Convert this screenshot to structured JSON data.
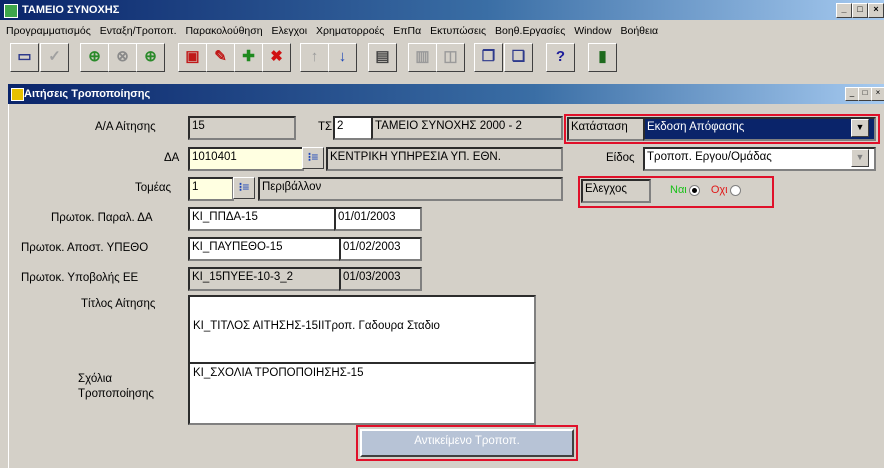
{
  "app": {
    "title": "ΤΑΜΕΙΟ ΣΥΝΟΧΗΣ",
    "controls": {
      "min": "_",
      "max": "□",
      "close": "×"
    }
  },
  "menu": [
    "Προγραμματισμός",
    "Ενταξη/Τροποπ.",
    "Παρακολούθηση",
    "Ελεγχοι",
    "Χρηματορροές",
    "ΕπΠα",
    "Εκτυπώσεις",
    "Βοηθ.Εργασίες",
    "Window",
    "Βοήθεια"
  ],
  "toolbar": {
    "icons": [
      {
        "name": "save-icon",
        "glyph": "▭",
        "color": "#2e3a8c"
      },
      {
        "name": "check-icon",
        "glyph": "✓",
        "color": "#a0a0a0"
      },
      {
        "name": "query-icon",
        "glyph": "⊕",
        "color": "#2a8a2a"
      },
      {
        "name": "query-cancel-icon",
        "glyph": "⊗",
        "color": "#8a8a8a"
      },
      {
        "name": "execute-query-icon",
        "glyph": "⊕",
        "color": "#2a8a2a"
      },
      {
        "name": "window-icon",
        "glyph": "▣",
        "color": "#c01818"
      },
      {
        "name": "edit-icon",
        "glyph": "✎",
        "color": "#c01818"
      },
      {
        "name": "insert-record-icon",
        "glyph": "✚",
        "color": "#1e8a1e"
      },
      {
        "name": "delete-record-icon",
        "glyph": "✖",
        "color": "#d01010"
      },
      {
        "name": "previous-record-icon",
        "glyph": "↑",
        "color": "#9a9a9a"
      },
      {
        "name": "next-record-icon",
        "glyph": "↓",
        "color": "#1c46b8"
      },
      {
        "name": "print-icon",
        "glyph": "▤",
        "color": "#444"
      },
      {
        "name": "list-icon",
        "glyph": "▥",
        "color": "#9a9a9a"
      },
      {
        "name": "chart-icon",
        "glyph": "◫",
        "color": "#9a9a9a"
      },
      {
        "name": "copy-icon",
        "glyph": "❐",
        "color": "#2e3a8c"
      },
      {
        "name": "paste-icon",
        "glyph": "❏",
        "color": "#2e3a8c"
      },
      {
        "name": "help-icon",
        "glyph": "?",
        "color": "#1c1c9a"
      },
      {
        "name": "exit-icon",
        "glyph": "▮",
        "color": "#1e6a1e"
      }
    ]
  },
  "child_window": {
    "title": "Αιτήσεις Τροποποίησης",
    "controls": {
      "min": "_",
      "max": "□",
      "close": "×"
    }
  },
  "form": {
    "aa_label": "Α/Α Αίτησης",
    "aa_value": "15",
    "ts_label": "ΤΣ",
    "ts_value": "2",
    "ts_desc": "ΤΑΜΕΙΟ ΣΥΝΟΧΗΣ 2000 - 2",
    "status_label": "Κατάσταση",
    "status_value": "Εκδοση Απόφασης",
    "da_label": "ΔΑ",
    "da_value": "1010401",
    "da_desc": "ΚΕΝΤΡΙΚΗ ΥΠΗΡΕΣΙΑ ΥΠ. ΕΘΝ.",
    "type_label": "Είδος",
    "type_value": "Τροποπ. Εργου/Ομάδας",
    "sector_label": "Τομέας",
    "sector_value": "1",
    "sector_desc": "Περιβάλλον",
    "control_label": "Ελεγχος",
    "control_yes": "Ναι",
    "control_no": "Οχι",
    "control_yes_color": "#18c018",
    "control_no_color": "#e01818",
    "protok_da_label": "Πρωτοκ. Παραλ. ΔΑ",
    "protok_da_value": "ΚΙ_ΠΠΔΑ-15",
    "protok_da_date": "01/01/2003",
    "protok_ypetho_label": "Πρωτοκ. Αποστ. ΥΠΕΘΟ",
    "protok_ypetho_value": "ΚΙ_ΠΑΥΠΕΘΟ-15",
    "protok_ypetho_date": "01/02/2003",
    "protok_ee_label": "Πρωτοκ. Υποβολής ΕΕ",
    "protok_ee_value": "ΚΙ_15ΠΥΕΕ-10-3_2",
    "protok_ee_date": "01/03/2003",
    "title_label": "Τίτλος Αίτησης",
    "title_value": "ΚΙ_ΤΙΤΛΟΣ ΑΙΤΗΣΗΣ-15ΙΙΤροπ. Γαδουρα Σταδιο",
    "comments_label_1": "Σχόλια",
    "comments_label_2": "Τροποποίησης",
    "comments_value": "ΚΙ_ΣΧΟΛΙΑ ΤΡΟΠΟΠΟΙΗΣΗΣ-15",
    "object_button": "Αντικείμενο Τροποπ."
  },
  "highlight_color": "#e0102a"
}
